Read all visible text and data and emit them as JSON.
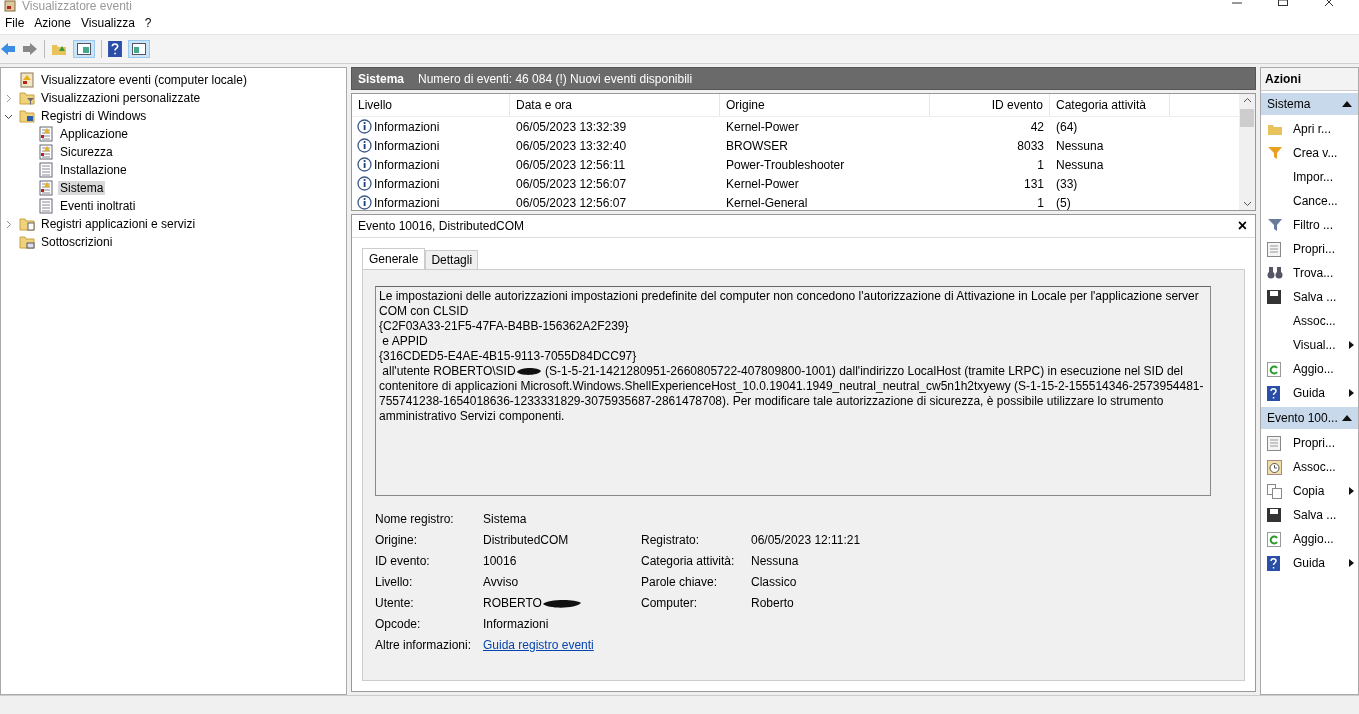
{
  "window": {
    "title": "Visualizzatore eventi"
  },
  "menu": [
    "File",
    "Azione",
    "Visualizza",
    "?"
  ],
  "tree": [
    {
      "label": "Visualizzatore eventi (computer locale)",
      "selected": false,
      "children": [
        {
          "label": "Visualizzazioni personalizzate",
          "expanded": false,
          "selected": false
        },
        {
          "label": "Registri di Windows",
          "expanded": true,
          "selected": false,
          "children": [
            {
              "label": "Applicazione",
              "selected": false
            },
            {
              "label": "Sicurezza",
              "selected": false
            },
            {
              "label": "Installazione",
              "selected": false
            },
            {
              "label": "Sistema",
              "selected": true
            },
            {
              "label": "Eventi inoltrati",
              "selected": false
            }
          ]
        },
        {
          "label": "Registri applicazioni e servizi",
          "expanded": false,
          "selected": false
        },
        {
          "label": "Sottoscrizioni",
          "selected": false
        }
      ]
    }
  ],
  "log_header": {
    "name": "Sistema",
    "info": "Numero di eventi: 46 084 (!) Nuovi eventi disponibili"
  },
  "table": {
    "columns": [
      "Livello",
      "Data e ora",
      "Origine",
      "ID evento",
      "Categoria attività"
    ],
    "rows": [
      {
        "level": "Informazioni",
        "date": "06/05/2023 13:32:39",
        "source": "Kernel-Power",
        "id": "42",
        "category": "(64)"
      },
      {
        "level": "Informazioni",
        "date": "06/05/2023 13:32:40",
        "source": "BROWSER",
        "id": "8033",
        "category": "Nessuna"
      },
      {
        "level": "Informazioni",
        "date": "06/05/2023 12:56:11",
        "source": "Power-Troubleshooter",
        "id": "1",
        "category": "Nessuna"
      },
      {
        "level": "Informazioni",
        "date": "06/05/2023 12:56:07",
        "source": "Kernel-Power",
        "id": "131",
        "category": "(33)"
      },
      {
        "level": "Informazioni",
        "date": "06/05/2023 12:56:07",
        "source": "Kernel-General",
        "id": "1",
        "category": "(5)"
      }
    ]
  },
  "event": {
    "title": "Evento 10016, DistributedCOM",
    "close": "×",
    "tabs": [
      {
        "label": "Generale",
        "selected": true
      },
      {
        "label": "Dettagli",
        "selected": false
      }
    ],
    "message_lines": [
      "Le impostazioni delle autorizzazioni impostazioni predefinite del computer non concedono l'autorizzazione di Attivazione in Locale per l'applicazione server COM con CLSID",
      "{C2F03A33-21F5-47FA-B4BB-156362A2F239}",
      " e APPID",
      "{316CDED5-E4AE-4B15-9113-7055D84DCC97}"
    ],
    "user_line": {
      "before": " all'utente ROBERTO\\SID",
      "after": " (S-1-5-21-1421280951-2660805722-407809800-1001) dall'indirizzo LocalHost (tramite LRPC) in esecuzione nel SID del contenitore di applicazioni Microsoft.Windows.ShellExperienceHost_10.0.19041.1949_neutral_neutral_cw5n1h2txyewy (S-1-15-2-155514346-2573954481-755741238-1654018636-1233331829-3075935687-2861478708). Per modificare tale autorizzazione di sicurezza, è possibile utilizzare lo strumento amministrativo Servizi componenti."
    },
    "details": [
      {
        "label": "Nome registro:",
        "value": "Sistema"
      },
      {
        "label": "Origine:",
        "value": "DistributedCOM",
        "right_label": "Registrato:",
        "right_value": "06/05/2023 12:11:21"
      },
      {
        "label": "ID evento:",
        "value": "10016",
        "right_label": "Categoria attività:",
        "right_value": "Nessuna"
      },
      {
        "label": "Livello:",
        "value": "Avviso",
        "right_label": "Parole chiave:",
        "right_value": "Classico"
      },
      {
        "label": "Utente:",
        "value": "ROBERTO",
        "redacted": true,
        "right_label": "Computer:",
        "right_value": "Roberto"
      },
      {
        "label": "Opcode:",
        "value": "Informazioni"
      },
      {
        "label": "Altre informazioni:",
        "value": "Guida registro eventi",
        "kind": "link"
      }
    ]
  },
  "actions": {
    "title": "Azioni",
    "sections": [
      {
        "title": "Sistema",
        "expanded": true,
        "items": [
          {
            "label": "Apri r..."
          },
          {
            "label": "Crea v..."
          },
          {
            "label": "Impor..."
          },
          {
            "label": "Cance..."
          },
          {
            "label": "Filtro ..."
          },
          {
            "label": "Propri..."
          },
          {
            "label": "Trova..."
          },
          {
            "label": "Salva ..."
          },
          {
            "label": "Assoc..."
          },
          {
            "label": "Visual...",
            "submenu": true
          },
          {
            "label": "Aggio..."
          },
          {
            "label": "Guida",
            "submenu": true
          }
        ]
      },
      {
        "title": "Evento 100...",
        "expanded": true,
        "items": [
          {
            "label": "Propri..."
          },
          {
            "label": "Assoc..."
          },
          {
            "label": "Copia",
            "submenu": true
          },
          {
            "label": "Salva ..."
          },
          {
            "label": "Aggio..."
          },
          {
            "label": "Guida",
            "submenu": true
          }
        ]
      }
    ]
  }
}
